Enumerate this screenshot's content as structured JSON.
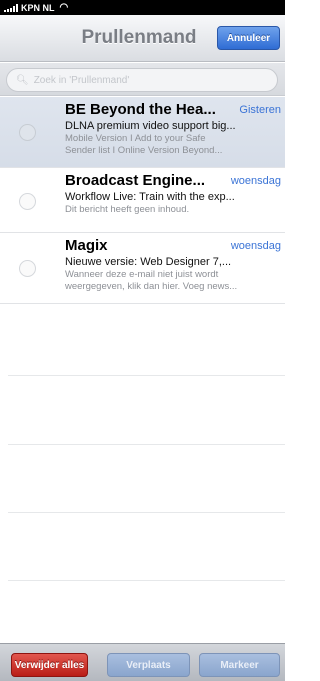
{
  "status_bar": {
    "carrier": "KPN NL",
    "signal_icon": "signal-bars-icon",
    "wifi_icon": "wifi-icon"
  },
  "nav": {
    "title": "Prullenmand",
    "cancel_label": "Annuleer"
  },
  "search": {
    "placeholder": "Zoek in 'Prullenmand'",
    "icon": "search-icon"
  },
  "messages": [
    {
      "sender": "BE Beyond the Hea...",
      "date": "Gisteren",
      "subject": "DLNA premium video support big...",
      "preview_line1": "Mobile Version  I  Add to your Safe",
      "preview_line2": "Sender list  I  Online Version Beyond...",
      "selected": true
    },
    {
      "sender": "Broadcast Engine...",
      "date": "woensdag",
      "subject": "Workflow Live: Train with the exp...",
      "preview_line1": "Dit bericht heeft geen inhoud.",
      "preview_line2": "",
      "selected": false
    },
    {
      "sender": "Magix",
      "date": "woensdag",
      "subject": "Nieuwe versie: Web Designer 7,...",
      "preview_line1": "Wanneer deze e-mail niet juist wordt",
      "preview_line2": "weergegeven, klik dan hier. Voeg news...",
      "selected": false
    }
  ],
  "toolbar": {
    "delete_all": "Verwijder alles",
    "move": "Verplaats",
    "mark": "Markeer"
  },
  "colors": {
    "accent_blue": "#3b74d6",
    "delete_red": "#c8261e",
    "nav_title": "#7a7e85"
  }
}
